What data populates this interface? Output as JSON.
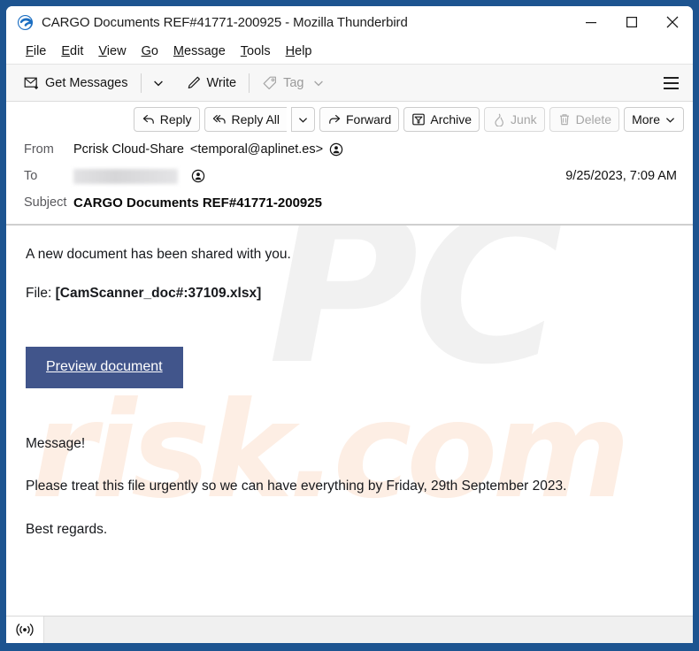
{
  "window": {
    "title": "CARGO Documents REF#41771-200925 - Mozilla Thunderbird",
    "app_icon": "thunderbird-icon",
    "border_color": "#1d5490",
    "controls": {
      "minimize": "minimize-icon",
      "maximize": "maximize-icon",
      "close": "close-icon"
    }
  },
  "menubar": {
    "items": [
      {
        "label": "File",
        "accel": "F",
        "rest": "ile"
      },
      {
        "label": "Edit",
        "accel": "E",
        "rest": "dit"
      },
      {
        "label": "View",
        "accel": "V",
        "rest": "iew"
      },
      {
        "label": "Go",
        "accel": "G",
        "rest": "o"
      },
      {
        "label": "Message",
        "accel": "M",
        "rest": "essage"
      },
      {
        "label": "Tools",
        "accel": "T",
        "rest": "ools"
      },
      {
        "label": "Help",
        "accel": "H",
        "rest": "elp"
      }
    ]
  },
  "toolbar": {
    "get_messages_label": "Get Messages",
    "get_messages_icon": "envelope-download-icon",
    "get_messages_chevron": "chevron-down-icon",
    "write_label": "Write",
    "write_icon": "pencil-icon",
    "tag_label": "Tag",
    "tag_icon": "tag-icon",
    "tag_chevron": "chevron-down-icon",
    "tag_disabled": true,
    "app_menu_icon": "hamburger-menu-icon"
  },
  "message_actions": [
    {
      "label": "Reply",
      "icon": "reply-arrow-icon",
      "disabled": false
    },
    {
      "label": "Reply All",
      "icon": "reply-all-arrow-icon",
      "disabled": false
    },
    {
      "label": "Forward",
      "icon": "forward-arrow-icon",
      "disabled": false
    },
    {
      "label": "Archive",
      "icon": "archive-box-icon",
      "disabled": false
    },
    {
      "label": "Junk",
      "icon": "flame-icon",
      "disabled": true
    },
    {
      "label": "Delete",
      "icon": "trash-icon",
      "disabled": true
    },
    {
      "label": "More",
      "icon": "chevron-down-icon",
      "disabled": false
    }
  ],
  "headers": {
    "from_label": "From",
    "from_display_name": "Pcrisk Cloud-Share",
    "from_address": "<temporal@aplinet.es>",
    "from_contact_icon": "contact-avatar-icon",
    "to_label": "To",
    "to_value": "",
    "to_redacted": true,
    "to_contact_icon": "contact-avatar-icon",
    "subject_label": "Subject",
    "subject_value": "CARGO Documents REF#41771-200925",
    "date": "9/25/2023, 7:09 AM"
  },
  "body": {
    "intro": "A new document has been shared with you.",
    "file_label": "File:",
    "file_name": "[CamScanner_doc#:37109.xlsx]",
    "cta_label": "Preview document",
    "cta_color": "#41558b",
    "message_heading": "Message!",
    "message_text": "Please treat this file urgently so we can have everything by Friday, 29th September 2023.",
    "signoff": "Best regards."
  },
  "watermark": {
    "part_one": "PC",
    "part_two": "risk.com",
    "color_one": "#f1f1f1",
    "color_two": "#fdeee4"
  },
  "statusbar": {
    "signal_icon": "broadcast-signal-icon",
    "progress_text": ""
  }
}
